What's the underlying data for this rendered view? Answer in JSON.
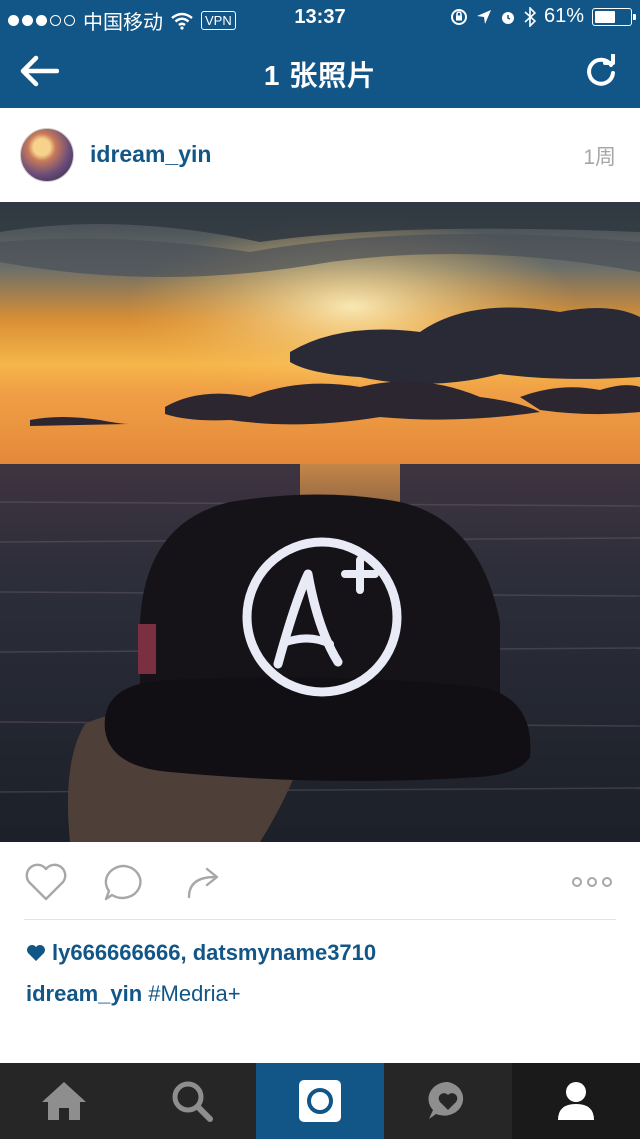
{
  "status_bar": {
    "carrier": "中国移动",
    "vpn": "VPN",
    "time": "13:37",
    "battery": "61%",
    "battery_level": 0.61
  },
  "nav": {
    "title": "1 张照片"
  },
  "post": {
    "username": "idream_yin",
    "time_ago": "1周",
    "likes_text": "ly666666666, datsmyname3710",
    "caption_user": "idream_yin",
    "caption_text": "#Medria+"
  },
  "colors": {
    "brand": "#125688",
    "tabbar": "#262626",
    "muted": "#a5a7aa"
  },
  "icons": [
    "back-arrow-icon",
    "refresh-icon",
    "heart-icon",
    "comment-icon",
    "share-icon",
    "more-icon",
    "home-icon",
    "search-icon",
    "camera-icon",
    "activity-icon",
    "profile-icon"
  ]
}
